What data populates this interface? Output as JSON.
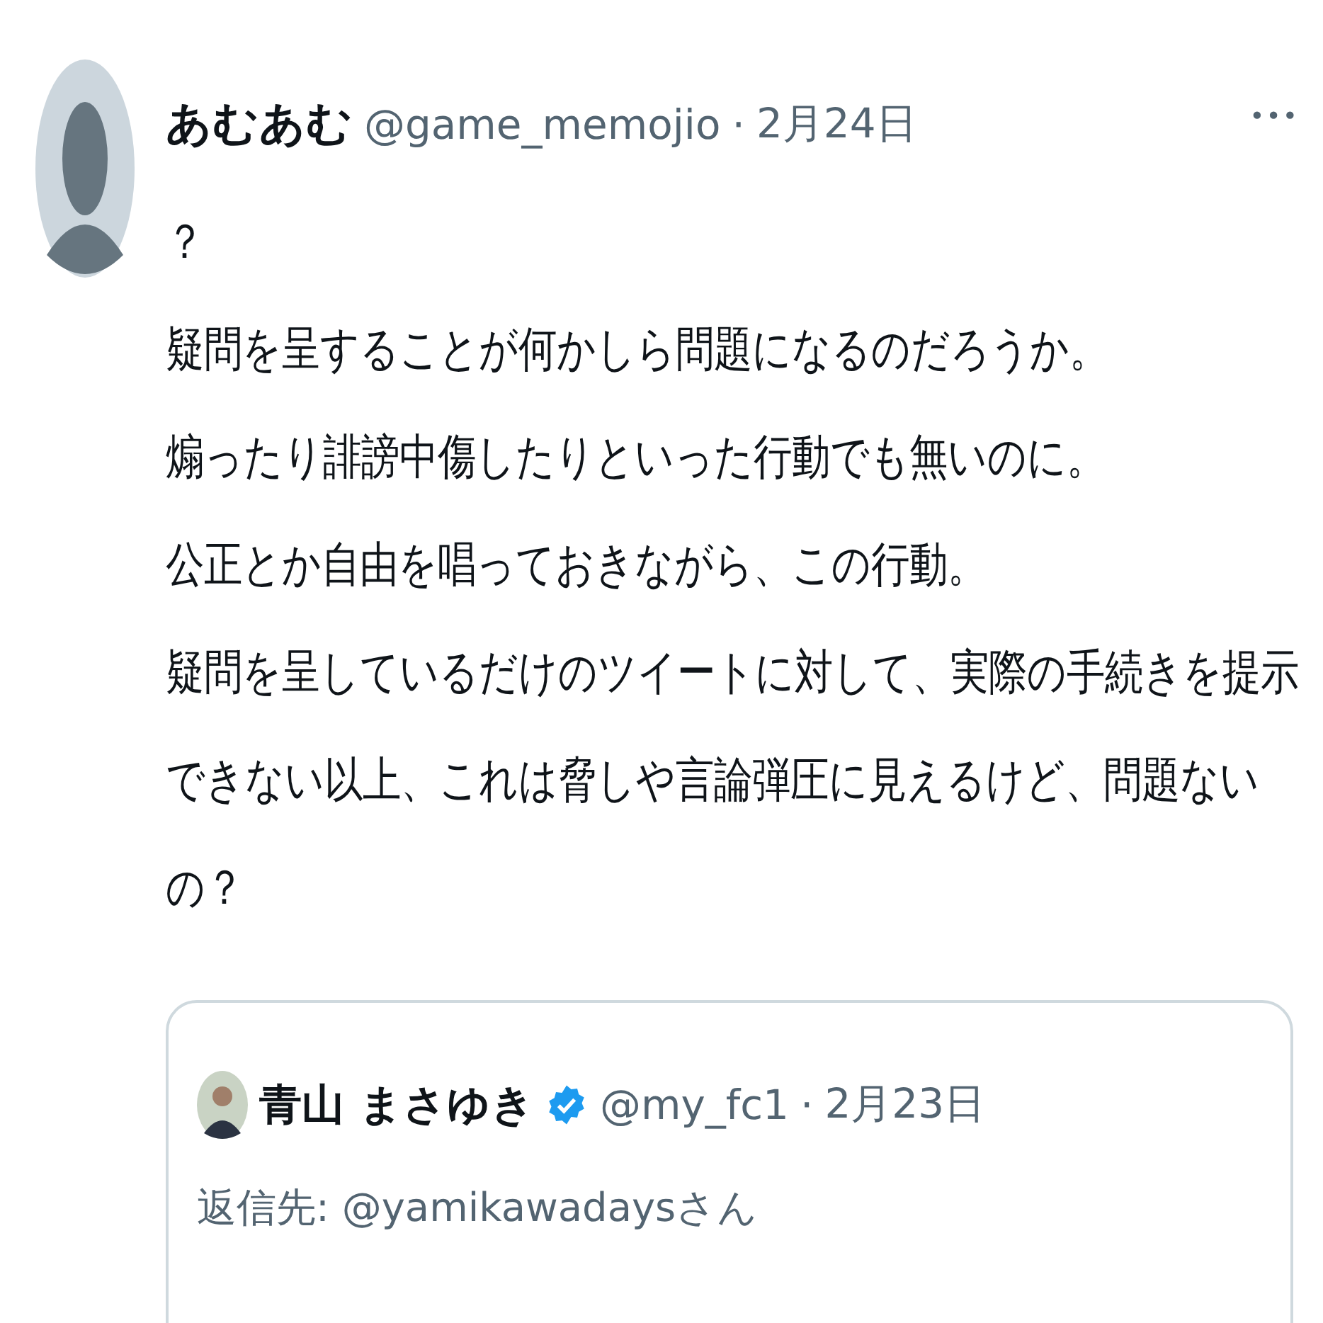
{
  "tweet": {
    "name": "あむあむ",
    "handle": "@game_memojio",
    "separator": "·",
    "date": "2月24日",
    "more": "•••",
    "lines": [
      "？",
      "疑問を呈することが何かしら問題になるのだろうか。",
      "煽ったり誹謗中傷したりといった行動でも無いのに。",
      "公正とか自由を唱っておきながら、この行動。",
      "疑問を呈しているだけのツイートに対して、実際の手続きを提示",
      "できない以上、これは脅しや言論弾圧に見えるけど、問題ない",
      "の？"
    ]
  },
  "quoted": {
    "name": "青山 まさゆき",
    "verified": true,
    "handle": "@my_fc1",
    "separator": "·",
    "date": "2月23日",
    "reply_to": "返信先: @yamikawadaysさん"
  }
}
